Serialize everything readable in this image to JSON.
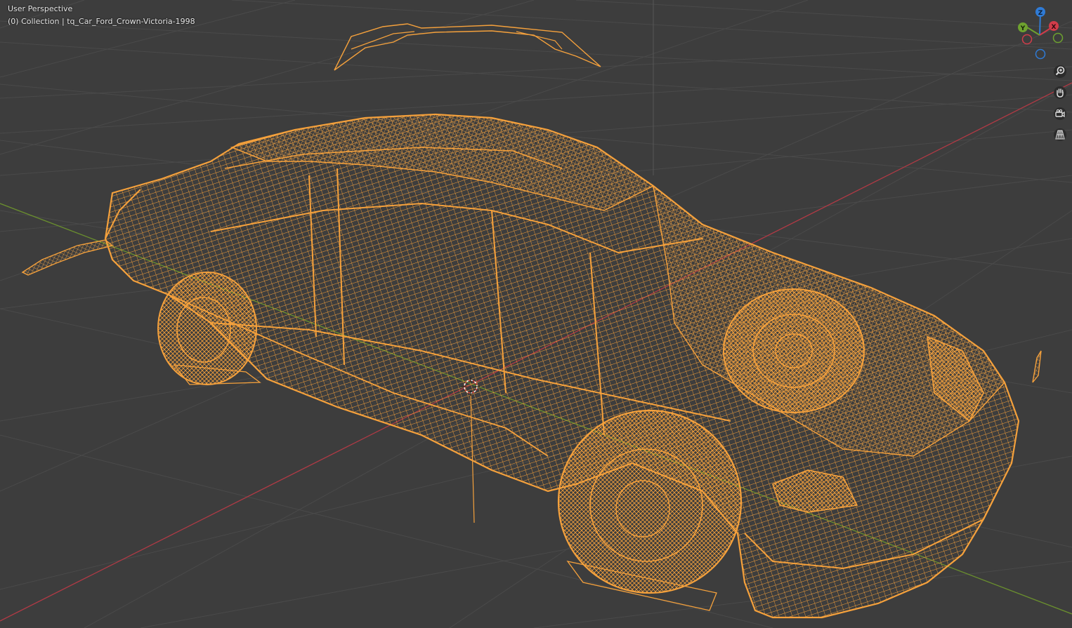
{
  "header": {
    "view_name": "User Perspective",
    "collection_prefix": "(0) Collection",
    "separator": "|",
    "object_name": "tq_Car_Ford_Crown-Victoria-1998"
  },
  "gizmo": {
    "axes": {
      "z": {
        "label": "Z",
        "color": "#2f7bd6"
      },
      "y": {
        "label": "Y",
        "color": "#6ea22f"
      },
      "x": {
        "label": "X",
        "color": "#d23c4a"
      },
      "neg_x_color": "#7e2a33",
      "neg_y_color": "#4a6d22",
      "neg_z_color": "#24528c"
    }
  },
  "nav_buttons": [
    {
      "name": "zoom-button",
      "icon": "zoom-in-icon"
    },
    {
      "name": "pan-button",
      "icon": "hand-icon"
    },
    {
      "name": "camera-view-button",
      "icon": "camera-icon"
    },
    {
      "name": "ortho-toggle-button",
      "icon": "grid-icon"
    }
  ],
  "colors": {
    "background": "#3d3d3d",
    "grid_line": "#4a4a4a",
    "x_axis_line": "#b03a45",
    "y_axis_line": "#6a8f2e",
    "wireframe_selected": "#f5a13c"
  }
}
